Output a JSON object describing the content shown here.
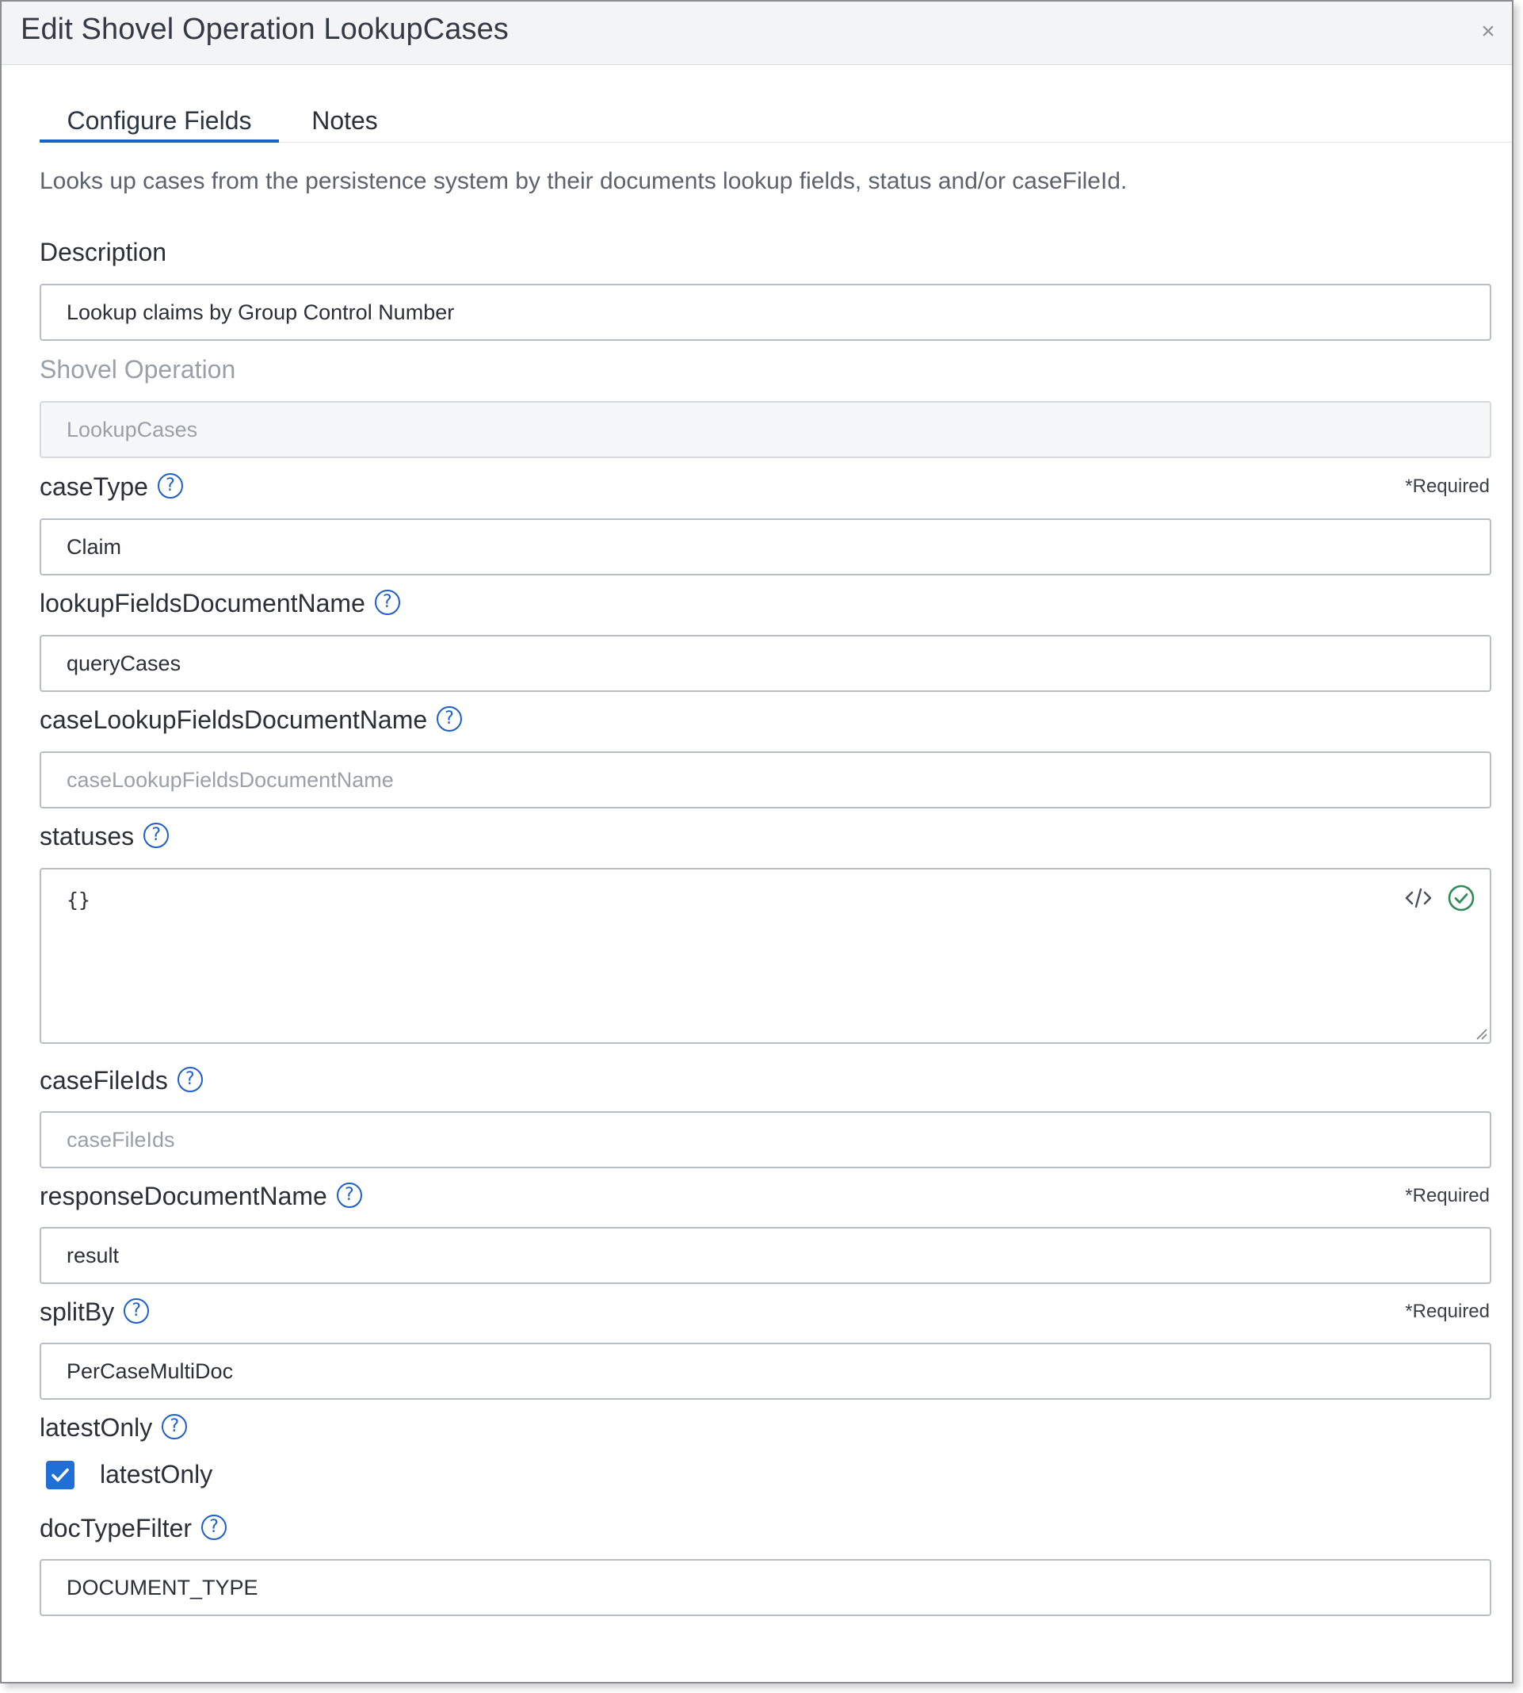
{
  "dialog": {
    "title": "Edit Shovel Operation LookupCases",
    "close_glyph": "×"
  },
  "tabs": [
    {
      "label": "Configure Fields",
      "active": true
    },
    {
      "label": "Notes",
      "active": false
    }
  ],
  "intro": "Looks up cases from the persistence system by their documents lookup fields, status and/or caseFileId.",
  "required_label": "*Required",
  "fields": {
    "description": {
      "label": "Description",
      "value": "Lookup claims by Group Control Number"
    },
    "shovel_operation": {
      "label": "Shovel Operation",
      "value": "LookupCases"
    },
    "caseType": {
      "label": "caseType",
      "value": "Claim"
    },
    "lookupFieldsDocumentName": {
      "label": "lookupFieldsDocumentName",
      "value": "queryCases"
    },
    "caseLookupFieldsDocumentName": {
      "label": "caseLookupFieldsDocumentName",
      "placeholder": "caseLookupFieldsDocumentName"
    },
    "statuses": {
      "label": "statuses",
      "value": "{}"
    },
    "caseFileIds": {
      "label": "caseFileIds",
      "placeholder": "caseFileIds"
    },
    "responseDocumentName": {
      "label": "responseDocumentName",
      "value": "result"
    },
    "splitBy": {
      "label": "splitBy",
      "value": "PerCaseMultiDoc"
    },
    "latestOnly": {
      "label": "latestOnly",
      "checkbox_label": "latestOnly",
      "checked": true
    },
    "docTypeFilter": {
      "label": "docTypeFilter",
      "value": "DOCUMENT_TYPE"
    }
  },
  "help_glyph": "?",
  "colors": {
    "accent": "#1f5fc9",
    "checkbox": "#1f6fd6",
    "valid": "#2e8b57"
  }
}
